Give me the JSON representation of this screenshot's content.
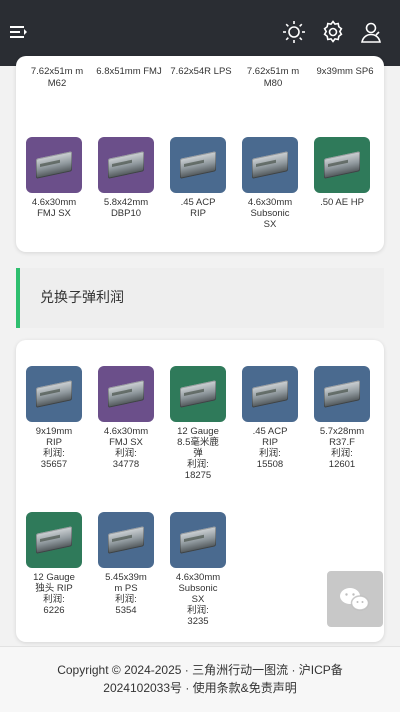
{
  "header": {
    "menu_icon": "menu-collapse-icon",
    "theme_icon": "sun-icon",
    "settings_icon": "gear-icon",
    "user_icon": "user-icon"
  },
  "top_section": {
    "partial_labels": [
      "7.62x51m\nm M62",
      "6.8x51mm\nFMJ",
      "7.62x54R\nLPS",
      "7.62x51m\nm M80",
      "9x39mm\nSP6"
    ],
    "items": [
      {
        "name": "4.6x30mm\nFMJ SX",
        "color": "#6b4f8a"
      },
      {
        "name": "5.8x42mm\nDBP10",
        "color": "#6b4f8a"
      },
      {
        "name": ".45 ACP\nRIP",
        "color": "#4a6a8f"
      },
      {
        "name": "4.6x30mm\nSubsonic\nSX",
        "color": "#4a6a8f"
      },
      {
        "name": ".50 AE HP",
        "color": "#2f7a5a"
      }
    ]
  },
  "section_title": "兑换子弹利润",
  "profit_items": [
    {
      "name": "9x19mm\nRIP",
      "profit_label": "利润:",
      "profit": "35657",
      "color": "#4a6a8f"
    },
    {
      "name": "4.6x30mm\nFMJ SX",
      "profit_label": "利润:",
      "profit": "34778",
      "color": "#6b4f8a"
    },
    {
      "name": "12 Gauge\n8.5毫米鹿\n弹",
      "profit_label": "利润:",
      "profit": "18275",
      "color": "#2f7a5a"
    },
    {
      "name": ".45 ACP\nRIP",
      "profit_label": "利润:",
      "profit": "15508",
      "color": "#4a6a8f"
    },
    {
      "name": "5.7x28mm\nR37.F",
      "profit_label": "利润:",
      "profit": "12601",
      "color": "#4a6a8f"
    },
    {
      "name": "12 Gauge\n独头 RIP",
      "profit_label": "利润:",
      "profit": "6226",
      "color": "#2f7a5a"
    },
    {
      "name": "5.45x39m\nm PS",
      "profit_label": "利润:",
      "profit": "5354",
      "color": "#4a6a8f"
    },
    {
      "name": "4.6x30mm\nSubsonic\nSX",
      "profit_label": "利润:",
      "profit": "3235",
      "color": "#4a6a8f"
    }
  ],
  "footer": {
    "line1": "Copyright © 2024-2025 · 三角洲行动一图流 · 沪ICP备",
    "line2": "2024102033号 · 使用条款&免责声明"
  },
  "floating": {
    "icon": "wechat-icon"
  }
}
